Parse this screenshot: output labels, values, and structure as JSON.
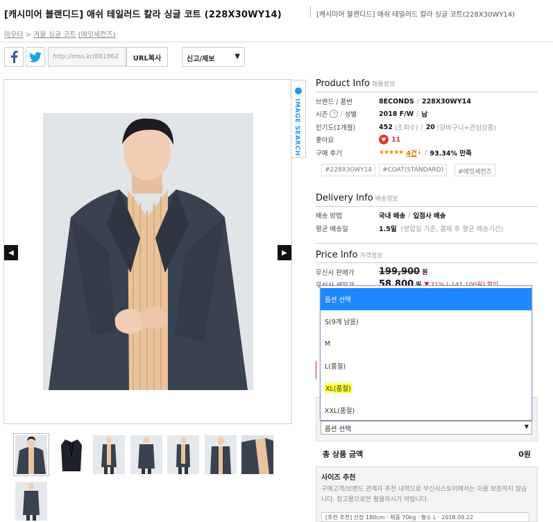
{
  "header": {
    "title": "[캐시미어 블랜디드] 애쉬 테일러드 칼라 싱글 코트 (228X30WY14)",
    "title_sub": "[캐시미어 블랜디드] 애쉬 테일러드 칼라 싱글 코트(228X30WY14)",
    "breadcrumb": [
      "아우터",
      "겨울 싱글 코트",
      "(에잇세컨즈)"
    ],
    "breadcrumb_sep": ">"
  },
  "share": {
    "facebook_icon": "facebook-icon",
    "twitter_icon": "twitter-icon",
    "url_value": "http://mss.kr/881862",
    "url_copy_label": "URL복사",
    "report_label": "신고/제보",
    "report_arrow": "▼"
  },
  "gallery": {
    "image_search_label": "IMAGE SEARCH",
    "prev_arrow": "◀",
    "next_arrow": "▶",
    "thumb_count": 8
  },
  "product_info": {
    "title": "Product Info",
    "title_ko": "제품정보",
    "brand_label": "브랜드 / 품번",
    "brand": "8ECONDS",
    "code": "228X30WY14",
    "season_label": "시즌",
    "gender_label": "성별",
    "season": "2018 F/W",
    "gender": "남",
    "popularity_label": "인기도(1개월)",
    "views": "452",
    "views_unit": "(조회수)",
    "cart": "20",
    "cart_unit": "(장바구니+관심상품)",
    "likes_label": "좋아요",
    "likes": "11",
    "review_label": "구매 후기",
    "stars": "★★★★★",
    "review_count": "4건",
    "satisfaction": "93.34% 만족",
    "tags": [
      "#228X30WY14",
      "#COAT(STANDARD)",
      "#에잇세컨즈"
    ]
  },
  "delivery_info": {
    "title": "Delivery Info",
    "title_ko": "배송정보",
    "method_label": "배송 방법",
    "method": "국내 배송",
    "method2": "입점사 배송",
    "avg_label": "평균 배송일",
    "avg": "1.5일",
    "avg_note": "(영업일 기준, 결제 후 평균 배송기간)"
  },
  "price_info": {
    "title": "Price Info",
    "title_ko": "가격정보",
    "list_label": "무신사 판매가",
    "list_price": "199,900",
    "won": "원",
    "sale_label": "무신사 세일가",
    "sale_price": "58,800",
    "discount": "71% (-141,100원) 할인"
  },
  "dropdown": {
    "options": [
      "옵션 선택",
      "S(9개 남음)",
      "M",
      "L(품절)",
      "XL(품절)",
      "XXL(품절)"
    ],
    "active_index": 0,
    "highlight_index": 4
  },
  "buy": {
    "select_value": "옵션 선택",
    "select_arrow": "▼",
    "total_label": "총 상품 금액",
    "total_value": "0원",
    "size_title": "사이즈 추천",
    "size_desc": "구매고객/브랜드 관계자 추천 내역으로 무신사스토어에서는 이를 보증하지 않습니다. 참고용으로만 활용하시기 바랍니다.",
    "bottom_row": "[추천 추천] 신장 180cm · 체중 70kg · 평소 L · 2018.09.22"
  },
  "colors": {
    "accent_blue": "#1e88ff",
    "highlight": "#ffff33",
    "discount_red": "#c62828",
    "star_orange": "#ff8a00",
    "coat_navy": "#3a4150"
  }
}
